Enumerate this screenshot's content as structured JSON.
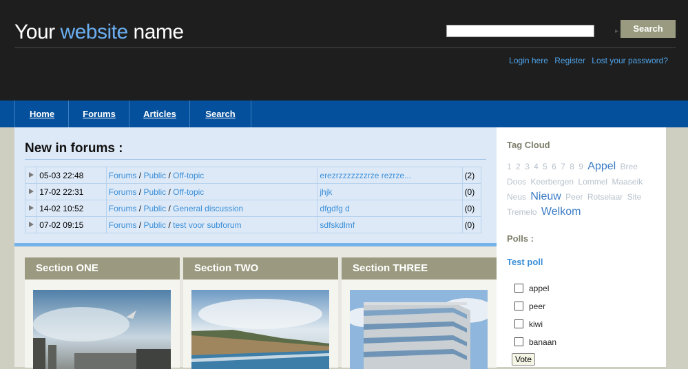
{
  "header": {
    "title_part1": "Your ",
    "title_accent": "website",
    "title_part2": " name",
    "search_button": "Search",
    "search_value": "",
    "links": [
      "Login here",
      "Register",
      "Lost your password?"
    ]
  },
  "nav": [
    "Home",
    "Forums",
    "Articles",
    "Search"
  ],
  "forums": {
    "title": "New in forums :",
    "rows": [
      {
        "date": "05-03 22:48",
        "path": [
          "Forums",
          "Public",
          "Off-topic"
        ],
        "topic": "erezrzzzzzzzrze rezrze...",
        "count": "(2)"
      },
      {
        "date": "17-02 22:31",
        "path": [
          "Forums",
          "Public",
          "Off-topic"
        ],
        "topic": "jhjk",
        "count": "(0)"
      },
      {
        "date": "14-02 10:52",
        "path": [
          "Forums",
          "Public",
          "General discussion"
        ],
        "topic": "dfgdfg d",
        "count": "(0)"
      },
      {
        "date": "07-02 09:15",
        "path": [
          "Forums",
          "Public",
          "test voor subforum"
        ],
        "topic": "sdfskdlmf",
        "count": "(0)"
      }
    ]
  },
  "sections": [
    "Section ONE",
    "Section TWO",
    "Section THREE"
  ],
  "sidebar": {
    "tag_cloud_title": "Tag Cloud",
    "tags": [
      "1",
      "2",
      "3",
      "4",
      "5",
      "6",
      "7",
      "8",
      "9",
      "Appel",
      "Bree",
      "Doos",
      "Keerbergen",
      "Lommel",
      "Maaseik",
      "Neus",
      "Nieuw",
      "Peer",
      "Rotselaar",
      "Site",
      "Tremelo",
      "Welkom"
    ],
    "big_tags": [
      "Appel",
      "Nieuw",
      "Welkom"
    ],
    "polls_title": "Polls :",
    "poll_name": "Test poll",
    "options": [
      "appel",
      "peer",
      "kiwi",
      "banaan"
    ],
    "vote_button": "Vote"
  },
  "colors": {
    "header_bg": "#1e1e1e",
    "nav_bg": "#04509c",
    "accent": "#6aaef0",
    "section_header": "#9b9a80",
    "link": "#3b8fd8"
  }
}
